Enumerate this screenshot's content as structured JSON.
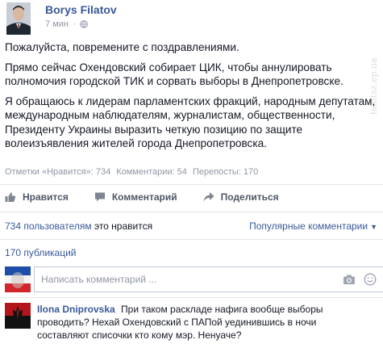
{
  "post": {
    "author": "Borys Filatov",
    "time": "7 мин",
    "dot": "·",
    "paragraphs": [
      "Пожалуйста, повремените с поздравлениями.",
      "Прямо сейчас Охендовский собирает ЦИК, чтобы аннулировать полномочия городской ТИК и сорвать выборы в Днепропетровске.",
      "Я обращаюсь к лидерам парламентских фракций, народным депутатам, международным наблюдателям, журналистам, общественности, Президенту Украины выразить четкую позицию по защите волеизъявления жителей города Днепропетровска."
    ],
    "stats": {
      "likes": "Отметки «Нравится»: 734",
      "comments": "Комментарии: 54",
      "shares": "Перепосты: 170"
    }
  },
  "actions": {
    "like": "Нравится",
    "comment": "Комментарий",
    "share": "Поделиться"
  },
  "likes_row": {
    "count_link": "734 пользователям",
    "suffix": "это нравится",
    "sort": "Популярные комментарии",
    "chevron": "▼"
  },
  "shares_row": {
    "label": "170 публикаций"
  },
  "comment_box": {
    "placeholder": "Написать комментарий ..."
  },
  "comments": [
    {
      "author": "Ilona Dniprovska",
      "text": "При таком раскладе нафига вообще выборы проводить? Нехай Охендовский с ПАПой уединившись в ночи составляют списочки кто кому мэр. Ненуаче?"
    }
  ],
  "watermark": "tsilitsz.ep.ua",
  "colors": {
    "link": "#3b5998",
    "text": "#141823",
    "muted": "#9197a3"
  },
  "icons": {
    "globe": "globe-icon",
    "like": "thumbs-up-icon",
    "comment": "speech-bubble-icon",
    "share": "share-arrow-icon",
    "camera": "camera-icon",
    "smile": "smiley-icon"
  }
}
